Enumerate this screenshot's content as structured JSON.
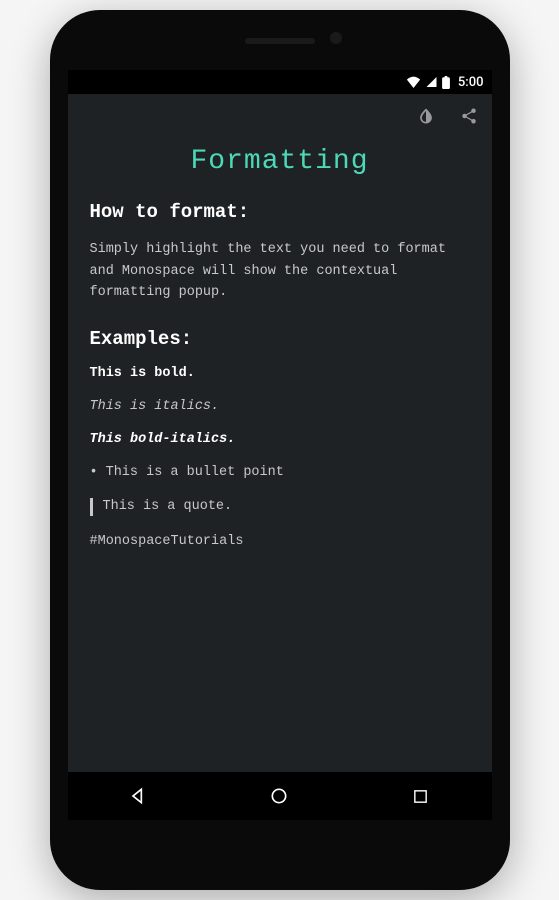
{
  "status_bar": {
    "time": "5:00"
  },
  "page": {
    "title": "Formatting",
    "how_to_heading": "How to format:",
    "how_to_body": "Simply highlight the text you need to format and Monospace will show the contextual formatting popup.",
    "examples_heading": "Examples:",
    "examples": {
      "bold": "This is bold.",
      "italic": "This is italics.",
      "bold_italic": "This bold-italics.",
      "bullet": "This is a bullet point",
      "quote": "This is a quote.",
      "hashtag": "#MonospaceTutorials"
    }
  }
}
